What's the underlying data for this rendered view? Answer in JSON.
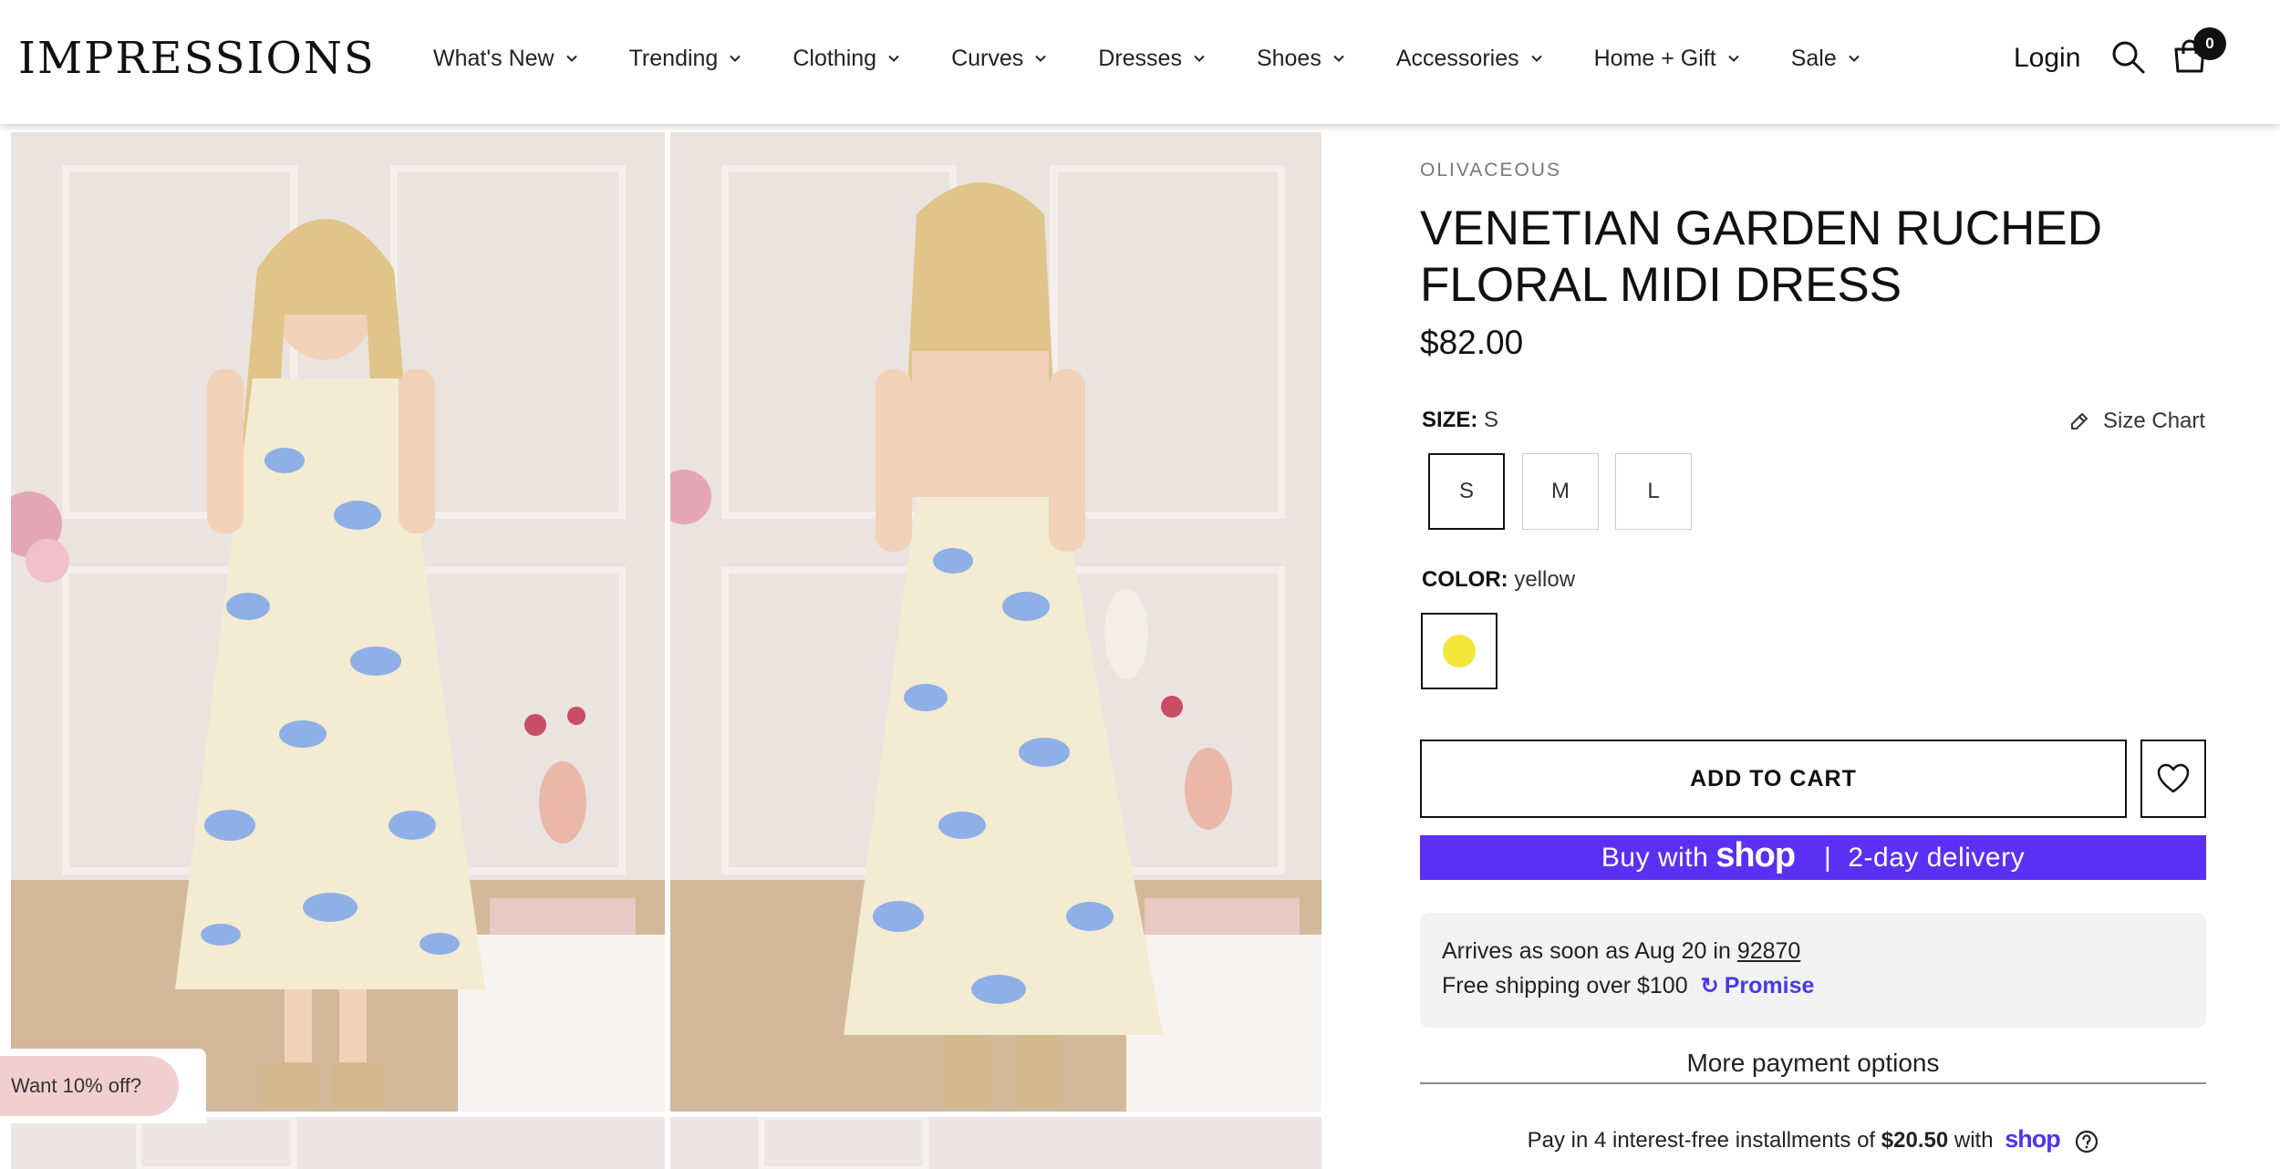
{
  "brand": {
    "logo_text": "IMPRESSIONS"
  },
  "nav": {
    "items": [
      {
        "label": "What's New"
      },
      {
        "label": "Trending"
      },
      {
        "label": "Clothing"
      },
      {
        "label": "Curves"
      },
      {
        "label": "Dresses"
      },
      {
        "label": "Shoes"
      },
      {
        "label": "Accessories"
      },
      {
        "label": "Home + Gift"
      },
      {
        "label": "Sale"
      }
    ],
    "login_label": "Login",
    "cart_count": "0",
    "search_icon": "search-icon",
    "cart_icon": "cart-icon"
  },
  "product": {
    "vendor": "OLIVACEOUS",
    "title": "VENETIAN GARDEN RUCHED FLORAL MIDI DRESS",
    "price": "$82.00",
    "size": {
      "label": "SIZE:",
      "selected": "S",
      "options": [
        "S",
        "M",
        "L"
      ],
      "size_chart_label": "Size Chart"
    },
    "color": {
      "label": "COLOR:",
      "selected": "yellow",
      "swatch_hex": "#f2e63a"
    },
    "add_to_cart_label": "ADD TO CART",
    "shop_pay": {
      "prefix": "Buy with",
      "brand": "shop",
      "separator": "|",
      "suffix": "2-day delivery",
      "color": "#5a31f4"
    },
    "delivery": {
      "arrives_text": "Arrives as soon as Aug 20 in",
      "zip": "92870",
      "free_shipping": "Free shipping over $100",
      "promise_label": "Promise",
      "promise_color": "#4a37e6"
    },
    "more_payment_label": "More payment options",
    "installments": {
      "prefix": "Pay in 4 interest-free installments of",
      "amount": "$20.50",
      "with": "with",
      "brand": "shop"
    }
  },
  "promo": {
    "label": "Want 10% off?"
  }
}
